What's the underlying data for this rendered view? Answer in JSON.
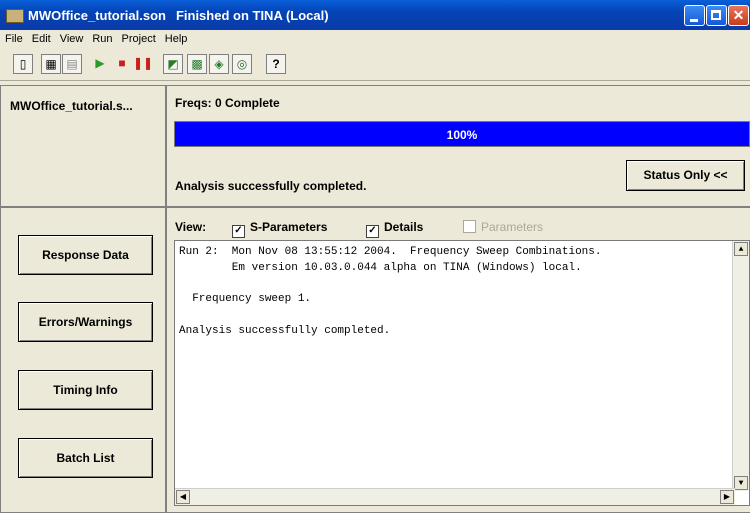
{
  "window": {
    "title_file": "MWOffice_tutorial.son",
    "title_status": "Finished on TINA (Local)"
  },
  "menu": [
    "File",
    "Edit",
    "View",
    "Run",
    "Project",
    "Help"
  ],
  "toolbar_icons": [
    "new-icon",
    "copy-icon",
    "paste-icon",
    "run-icon",
    "stop-icon",
    "pause-icon",
    "chart-icon",
    "grid-icon",
    "layout-icon",
    "zoom-icon",
    "help-icon"
  ],
  "left": {
    "project_name": "MWOffice_tutorial.s...",
    "buttons": [
      "Response Data",
      "Errors/Warnings",
      "Timing Info",
      "Batch List"
    ]
  },
  "status": {
    "freqs": "Freqs: 0 Complete",
    "progress_label": "100%",
    "progress_value": 1.0,
    "message": "Analysis successfully completed.",
    "toggle_button": "Status Only <<"
  },
  "view": {
    "label": "View:",
    "options": [
      {
        "label": "S-Parameters",
        "checked": true,
        "enabled": true
      },
      {
        "label": "Details",
        "checked": true,
        "enabled": true
      },
      {
        "label": "Parameters",
        "checked": false,
        "enabled": false
      }
    ]
  },
  "log": [
    "Run 2:  Mon Nov 08 13:55:12 2004.  Frequency Sweep Combinations.",
    "        Em version 10.03.0.044 alpha on TINA (Windows) local.",
    "",
    "  Frequency sweep 1.",
    "",
    "Analysis successfully completed."
  ],
  "colors": {
    "progress_fill": "#0000ff",
    "titlebar": "#0a3ba8",
    "face": "#ece9d8"
  }
}
